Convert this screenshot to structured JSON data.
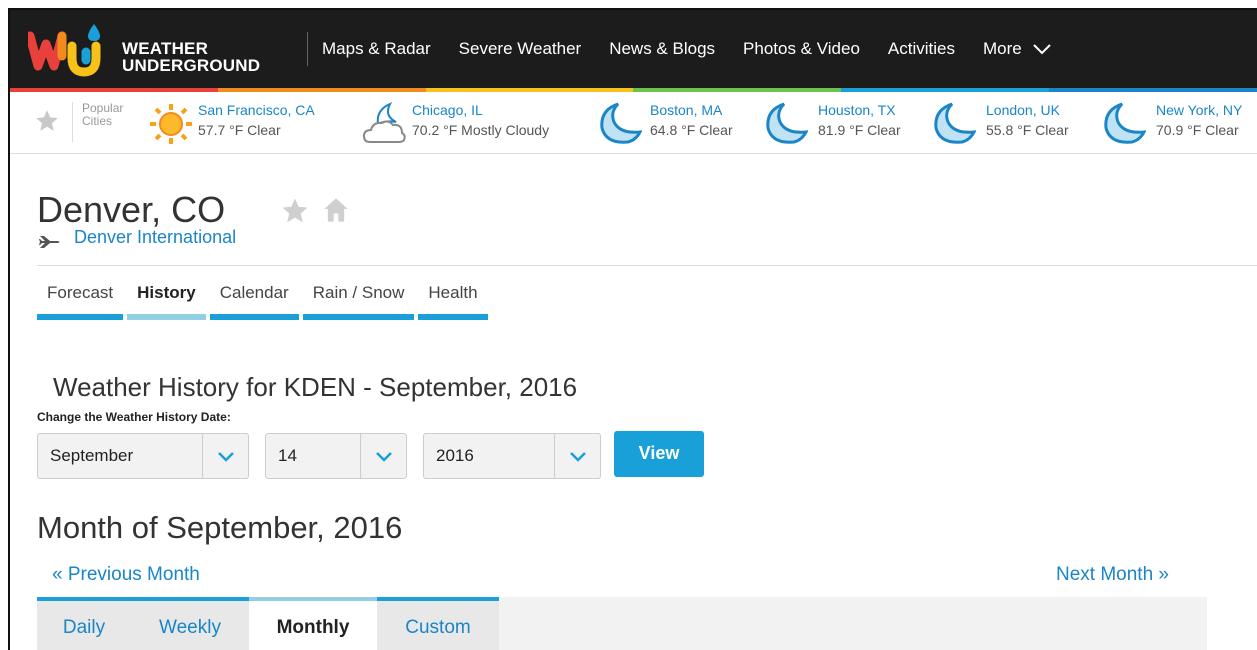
{
  "brand": {
    "line1": "WEATHER",
    "line2": "UNDERGROUND"
  },
  "nav": {
    "items": [
      {
        "label": "Maps & Radar"
      },
      {
        "label": "Severe Weather"
      },
      {
        "label": "News & Blogs"
      },
      {
        "label": "Photos & Video"
      },
      {
        "label": "Activities"
      },
      {
        "label": "More"
      }
    ]
  },
  "colors": {
    "accent": "#1aa0d8",
    "link": "#1a85c7",
    "nav_bg": "#1c1c1c",
    "rainbow": [
      "#e8413c",
      "#f28b1e",
      "#f6c21a",
      "#6cc24a",
      "#1aa0d8",
      "#1a85c7"
    ]
  },
  "popular": {
    "label_line1": "Popular",
    "label_line2": "Cities",
    "cities": [
      {
        "name": "San Francisco, CA",
        "weather": "57.7 °F Clear",
        "icon": "sun-icon"
      },
      {
        "name": "Chicago, IL",
        "weather": "70.2 °F Mostly Cloudy",
        "icon": "partly-cloudy-night-icon"
      },
      {
        "name": "Boston, MA",
        "weather": "64.8 °F Clear",
        "icon": "moon-icon"
      },
      {
        "name": "Houston, TX",
        "weather": "81.9 °F Clear",
        "icon": "moon-icon"
      },
      {
        "name": "London, UK",
        "weather": "55.8 °F Clear",
        "icon": "moon-icon"
      },
      {
        "name": "New York, NY",
        "weather": "70.9 °F Clear",
        "icon": "moon-icon"
      }
    ]
  },
  "location": {
    "title": "Denver, CO",
    "station": "Denver International"
  },
  "tabs": [
    {
      "label": "Forecast"
    },
    {
      "label": "History"
    },
    {
      "label": "Calendar"
    },
    {
      "label": "Rain / Snow"
    },
    {
      "label": "Health"
    }
  ],
  "history": {
    "title": "Weather History for KDEN - September, 2016",
    "change_label": "Change the Weather History Date:",
    "month": "September",
    "day": "14",
    "year": "2016",
    "view_label": "View"
  },
  "month_section": {
    "title": "Month of September, 2016",
    "prev": "« Previous Month",
    "next": "Next Month »",
    "tabs": [
      {
        "label": "Daily"
      },
      {
        "label": "Weekly"
      },
      {
        "label": "Monthly"
      },
      {
        "label": "Custom"
      }
    ]
  }
}
